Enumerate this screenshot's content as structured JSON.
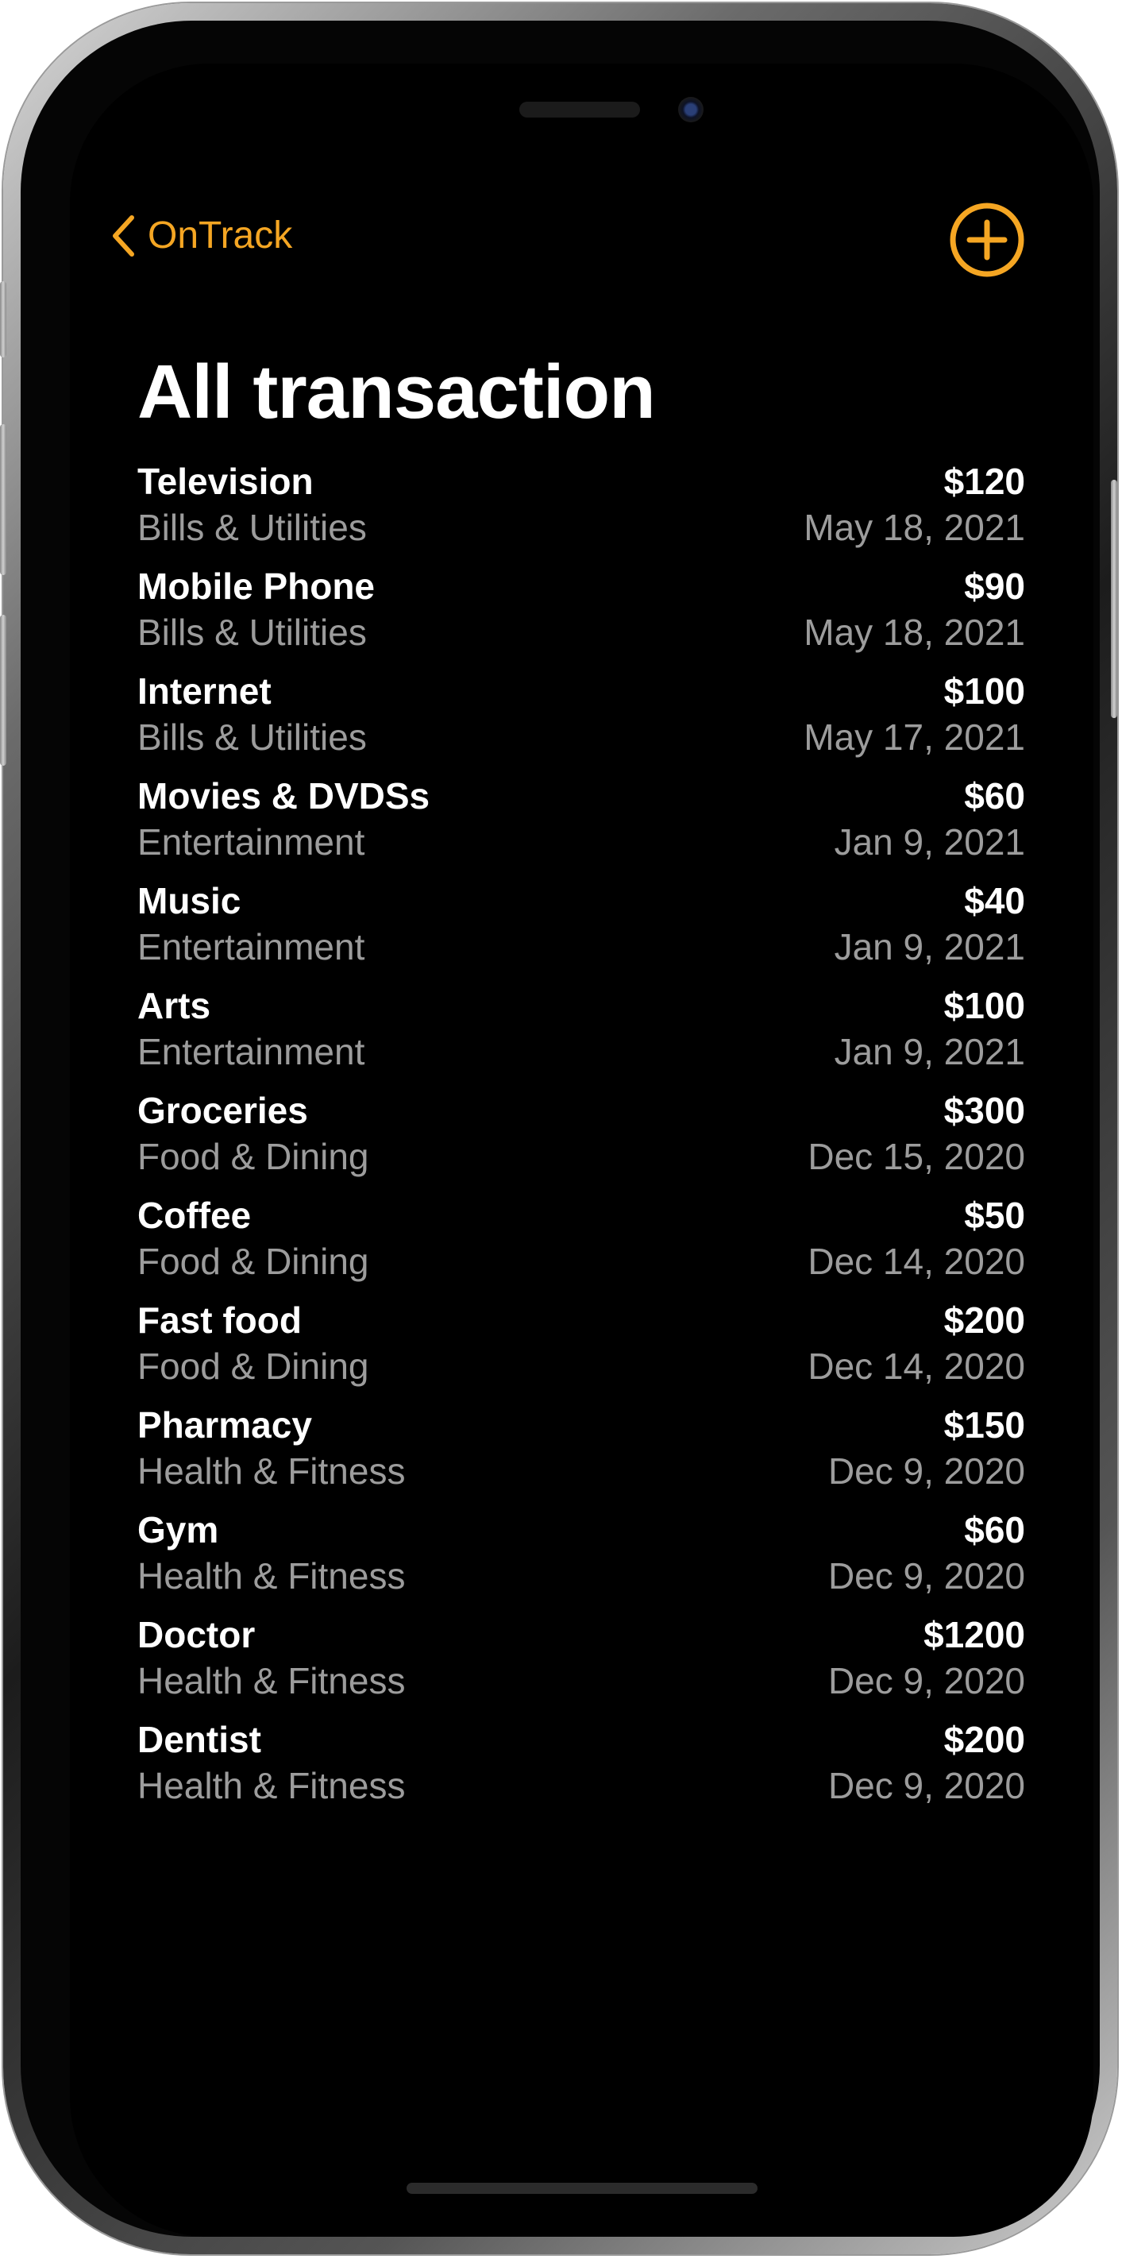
{
  "nav": {
    "back_label": "OnTrack",
    "back_icon": "chevron-left-icon",
    "add_icon": "plus-circle-icon",
    "accent_color": "#F5A623"
  },
  "page": {
    "title": "All transaction"
  },
  "transactions": [
    {
      "name": "Television",
      "category": "Bills & Utilities",
      "amount": "$120",
      "date": "May 18, 2021"
    },
    {
      "name": "Mobile Phone",
      "category": "Bills & Utilities",
      "amount": "$90",
      "date": "May 18, 2021"
    },
    {
      "name": "Internet",
      "category": "Bills & Utilities",
      "amount": "$100",
      "date": "May 17, 2021"
    },
    {
      "name": "Movies & DVDSs",
      "category": "Entertainment",
      "amount": "$60",
      "date": "Jan 9, 2021"
    },
    {
      "name": "Music",
      "category": "Entertainment",
      "amount": "$40",
      "date": "Jan 9, 2021"
    },
    {
      "name": "Arts",
      "category": "Entertainment",
      "amount": "$100",
      "date": "Jan 9, 2021"
    },
    {
      "name": "Groceries",
      "category": "Food & Dining",
      "amount": "$300",
      "date": "Dec 15, 2020"
    },
    {
      "name": "Coffee",
      "category": "Food & Dining",
      "amount": "$50",
      "date": "Dec 14, 2020"
    },
    {
      "name": "Fast food",
      "category": "Food & Dining",
      "amount": "$200",
      "date": "Dec 14, 2020"
    },
    {
      "name": "Pharmacy",
      "category": "Health & Fitness",
      "amount": "$150",
      "date": "Dec 9, 2020"
    },
    {
      "name": "Gym",
      "category": "Health & Fitness",
      "amount": "$60",
      "date": "Dec 9, 2020"
    },
    {
      "name": "Doctor",
      "category": "Health & Fitness",
      "amount": "$1200",
      "date": "Dec 9, 2020"
    },
    {
      "name": "Dentist",
      "category": "Health & Fitness",
      "amount": "$200",
      "date": "Dec 9, 2020"
    }
  ]
}
